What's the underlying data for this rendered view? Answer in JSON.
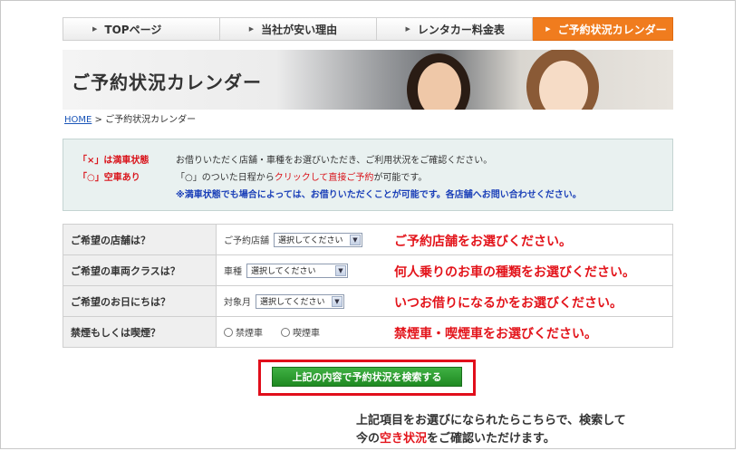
{
  "nav": {
    "items": [
      {
        "label": "TOPページ"
      },
      {
        "label": "当社が安い理由"
      },
      {
        "label": "レンタカー料金表"
      },
      {
        "label": "ご予約状況カレンダー"
      }
    ]
  },
  "banner": {
    "title": "ご予約状況カレンダー"
  },
  "breadcrumb": {
    "home": "HOME",
    "separator": ">",
    "current": "ご予約状況カレンダー"
  },
  "info": {
    "full_label": "「×」は満車状態",
    "available_label": "「○」空車あり",
    "line1": "お借りいただく店舗・車種をお選びいただき、ご利用状況をご確認ください。",
    "line2_pre": "「○」のついた日程から",
    "line2_red": "クリックして直接ご予約",
    "line2_post": "が可能です。",
    "line3": "※満車状態でも場合によっては、お借りいただくことが可能です。各店舗へお問い合わせください。"
  },
  "form": {
    "rows": [
      {
        "label": "ご希望の店舗は？",
        "field_label": "ご予約店舗",
        "select": "選択してください",
        "hint": "ご予約店舗をお選びください。"
      },
      {
        "label": "ご希望の車両クラスは？",
        "field_label": "車種",
        "select": "選択してください",
        "hint": "何人乗りのお車の種類をお選びください。"
      },
      {
        "label": "ご希望のお日にちは？",
        "field_label": "対象月",
        "select": "選択してください",
        "hint": "いつお借りになるかをお選びください。"
      },
      {
        "label": "禁煙もしくは喫煙？",
        "radio1": "禁煙車",
        "radio2": "喫煙車",
        "hint": "禁煙車・喫煙車をお選びください。"
      }
    ]
  },
  "search": {
    "label": "上記の内容で予約状況を検索する"
  },
  "note": {
    "line1": "上記項目をお選びになられたらこちらで、検索して",
    "line2_pre": "今の",
    "line2_red": "空き状況",
    "line2_post": "をご確認いただけます。"
  },
  "colors": {
    "accent_orange": "#f07c1e",
    "hint_red": "#e3141b",
    "button_green": "#2a9a2e",
    "notice_blue": "#1a3fb8"
  },
  "icons": {
    "nav_arrow": "triangle-right-icon",
    "select_arrow": "chevron-down-icon"
  }
}
